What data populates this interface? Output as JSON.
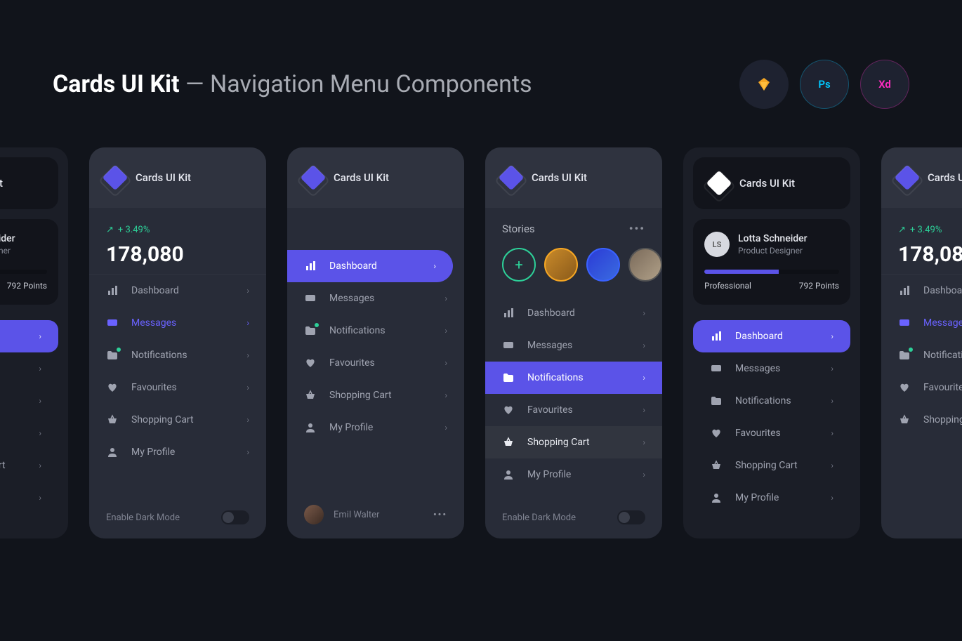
{
  "header": {
    "title_bold": "Cards UI Kit",
    "title_sep": " — ",
    "title_rest": "Navigation Menu Components"
  },
  "app_name": "Cards UI Kit",
  "stats": {
    "change": "+ 3.49%",
    "value": "178,080"
  },
  "profile": {
    "initials": "LS",
    "name": "Lotta Schneider",
    "role": "Product Designer",
    "level": "Professional",
    "points": "792 Points"
  },
  "stories": {
    "title": "Stories"
  },
  "menu": {
    "dashboard": "Dashboard",
    "messages": "Messages",
    "notifications": "Notifications",
    "favourites": "Favourites",
    "shopping_cart": "Shopping Cart",
    "my_profile": "My Profile"
  },
  "footer": {
    "dark_mode": "Enable Dark Mode",
    "user_name": "Emil Walter"
  }
}
